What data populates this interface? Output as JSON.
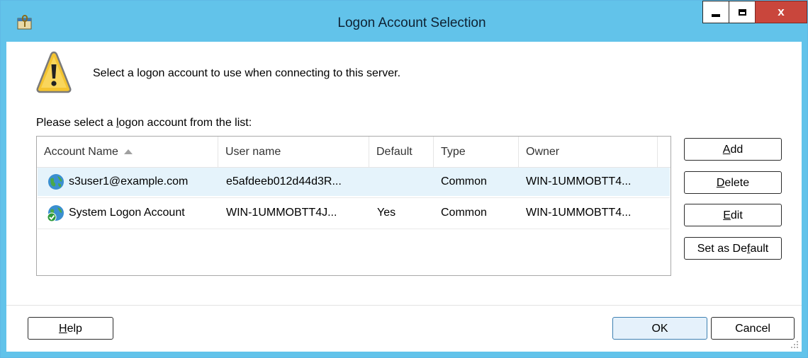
{
  "window": {
    "title": "Logon Account Selection",
    "icons": {
      "app": "key-window-icon",
      "minimize": "minimize-icon",
      "maximize": "maximize-icon",
      "close": "close-icon"
    },
    "close_label": "x"
  },
  "instruction": "Select a logon account to use when connecting to this server.",
  "list_label": {
    "before": "Please select a ",
    "underlined": "l",
    "after": "ogon account from the list:"
  },
  "table": {
    "columns": [
      "Account Name",
      "User name",
      "Default",
      "Type",
      "Owner"
    ],
    "sorted_by": "Account Name",
    "rows": [
      {
        "account_name": "s3user1@example.com",
        "user_name": "e5afdeeb012d44d3R...",
        "default": "",
        "type": "Common",
        "owner": "WIN-1UMMOBTT4...",
        "icon": "globe-user-icon",
        "selected": true
      },
      {
        "account_name": "System Logon Account",
        "user_name": "WIN-1UMMOBTT4J...",
        "default": "Yes",
        "type": "Common",
        "owner": "WIN-1UMMOBTT4...",
        "icon": "globe-check-icon",
        "selected": false
      }
    ]
  },
  "buttons": {
    "add": {
      "underlined": "A",
      "rest": "dd"
    },
    "delete": {
      "underlined": "D",
      "rest": "elete"
    },
    "edit": {
      "underlined": "E",
      "rest": "dit"
    },
    "set_default": {
      "before": "Set as De",
      "underlined": "f",
      "after": "ault"
    },
    "help": {
      "underlined": "H",
      "rest": "elp"
    },
    "ok": "OK",
    "cancel": "Cancel"
  },
  "colors": {
    "titlebar": "#62c3ea",
    "selection": "#e5f3fb",
    "close_button": "#c9463c",
    "warning": "#f4c430"
  }
}
